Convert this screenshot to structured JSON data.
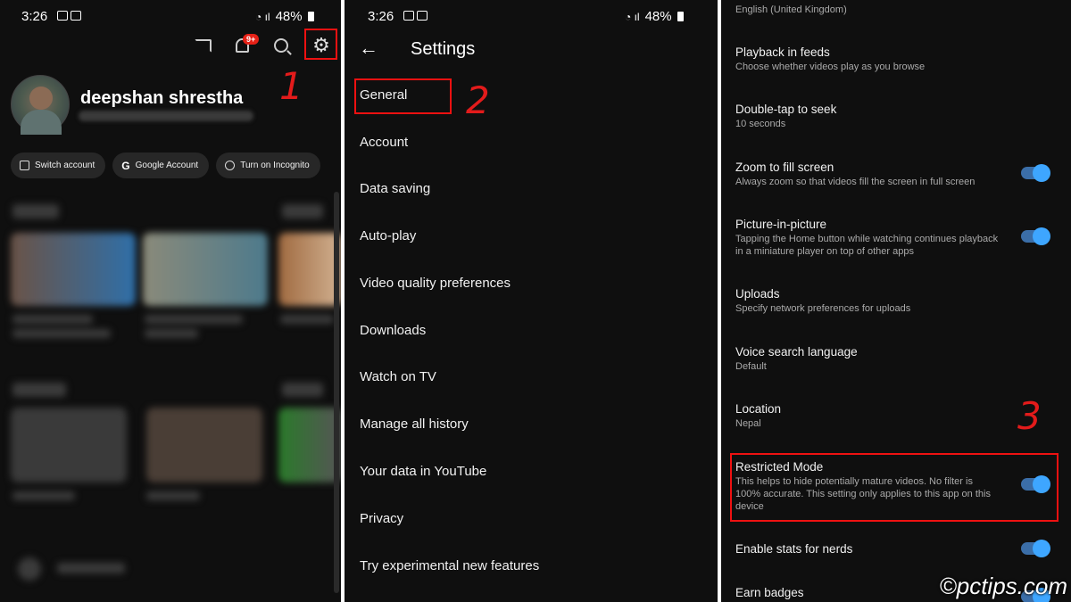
{
  "status_bar": {
    "time": "3:26",
    "battery": "48%"
  },
  "panel1": {
    "notification_badge": "9+",
    "annotation": "1",
    "username": "deepshan shrestha",
    "chips": [
      {
        "label": "Switch account",
        "icon": "switch-account-icon"
      },
      {
        "label": "Google Account",
        "icon": "google-g-icon",
        "glyph": "G"
      },
      {
        "label": "Turn on Incognito",
        "icon": "incognito-icon"
      }
    ]
  },
  "panel2": {
    "title": "Settings",
    "annotation": "2",
    "menu": [
      "General",
      "Account",
      "Data saving",
      "Auto-play",
      "Video quality preferences",
      "Downloads",
      "Watch on TV",
      "Manage all history",
      "Your data in YouTube",
      "Privacy",
      "Try experimental new features"
    ]
  },
  "panel3": {
    "annotation": "3",
    "top_partial": "English (United Kingdom)",
    "rows": [
      {
        "title": "Playback in feeds",
        "subtitle": "Choose whether videos play as you browse",
        "toggle": null
      },
      {
        "title": "Double-tap to seek",
        "subtitle": "10 seconds",
        "toggle": null
      },
      {
        "title": "Zoom to fill screen",
        "subtitle": "Always zoom so that videos fill the screen in full screen",
        "toggle": "on"
      },
      {
        "title": "Picture-in-picture",
        "subtitle": "Tapping the Home button while watching continues playback in a miniature player on top of other apps",
        "toggle": "on"
      },
      {
        "title": "Uploads",
        "subtitle": "Specify network preferences for uploads",
        "toggle": null
      },
      {
        "title": "Voice search language",
        "subtitle": "Default",
        "toggle": null
      },
      {
        "title": "Location",
        "subtitle": "Nepal",
        "toggle": null
      },
      {
        "title": "Restricted Mode",
        "subtitle": "This helps to hide potentially mature videos. No filter is 100% accurate. This setting only applies to this app on this device",
        "toggle": "on"
      },
      {
        "title": "Enable stats for nerds",
        "subtitle": "",
        "toggle": "on"
      },
      {
        "title": "Earn badges",
        "subtitle": "",
        "toggle": "on"
      }
    ],
    "watermark": "©pctips.com"
  },
  "colors": {
    "background": "#0f0f0f",
    "highlight": "#e11111",
    "toggle_on": "#3ea6ff"
  }
}
